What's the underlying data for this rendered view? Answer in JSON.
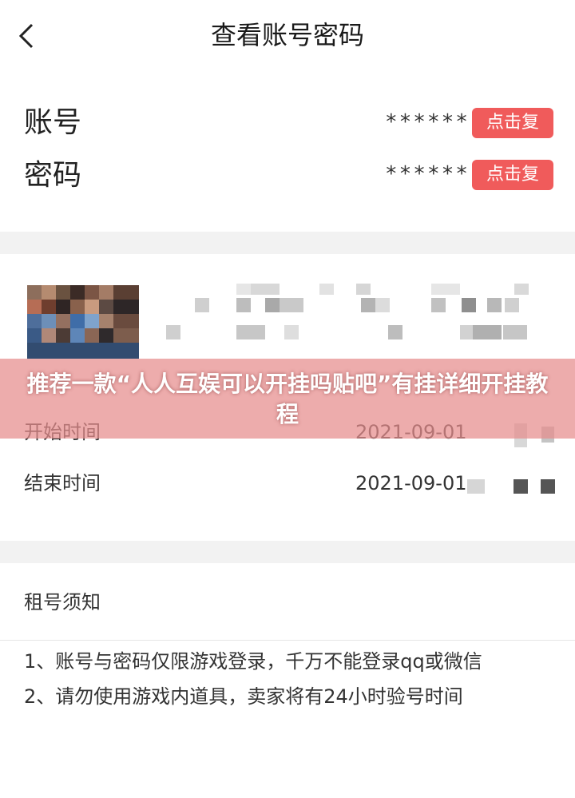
{
  "header": {
    "title": "查看账号密码",
    "back_icon": "chevron-left-icon"
  },
  "credentials": {
    "account_label": "账号",
    "account_value": "******",
    "password_label": "密码",
    "password_value": "******",
    "copy_label": "点击复制",
    "copy_color": "#f05b5b"
  },
  "order": {
    "start_label": "开始时间",
    "start_value": "2021-09-01",
    "end_label": "结束时间",
    "end_value": "2021-09-01"
  },
  "notice": {
    "title": "租号须知",
    "lines": [
      "1、账号与密码仅限游戏登录，千万不能登录qq或微信",
      "2、请勿使用游戏内道具，卖家将有24小时验号时间"
    ]
  },
  "overlay": {
    "text": "推荐一款“人人互娱可以开挂吗贴吧”有挂详细开挂教程"
  }
}
